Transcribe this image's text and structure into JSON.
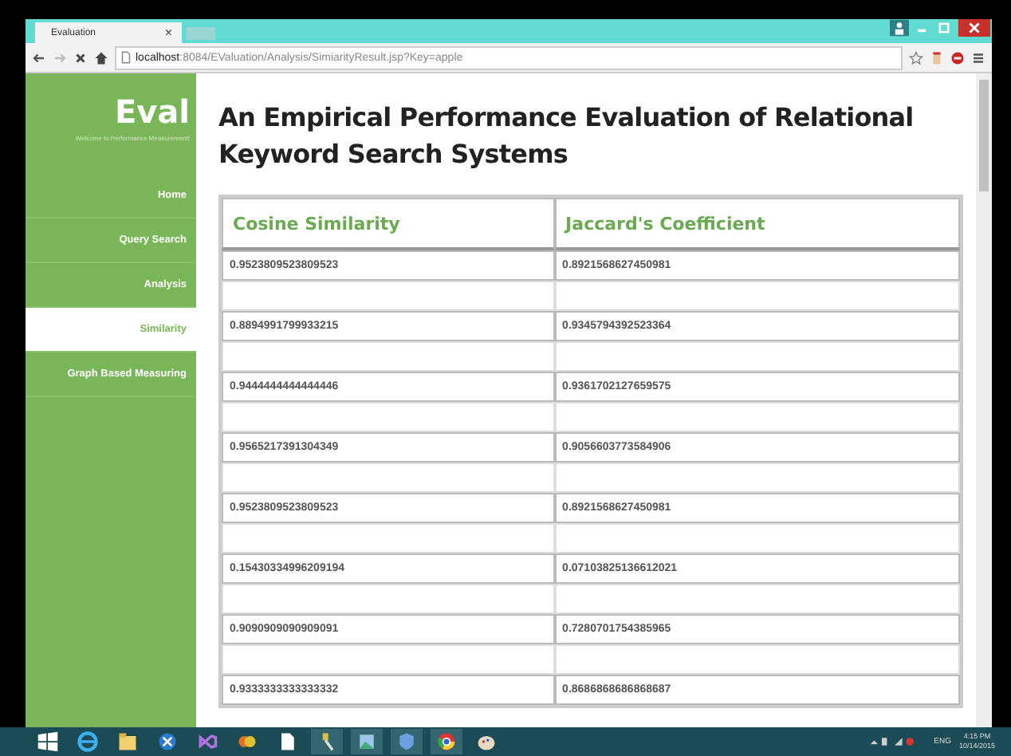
{
  "browser": {
    "tab_title": "Evaluation",
    "close_tab": "×",
    "url_host": "localhost",
    "url_path": ":8084/EValuation/Analysis/SimiarityResult.jsp?Key=apple"
  },
  "sidebar": {
    "brand": "Eval",
    "tagline": "Welcome to Performance Measurement!",
    "items": [
      {
        "label": "Home",
        "selected": false
      },
      {
        "label": "Query Search",
        "selected": false
      },
      {
        "label": "Analysis",
        "selected": false
      },
      {
        "label": "Similarity",
        "selected": true
      },
      {
        "label": "Graph Based Measuring",
        "selected": false
      }
    ]
  },
  "title": "An Empirical Performance Evaluation of Relational Keyword Search Systems",
  "table": {
    "columns": [
      "Cosine Similarity",
      "Jaccard's Coefficient"
    ],
    "rows": [
      [
        "0.9523809523809523",
        "0.8921568627450981"
      ],
      [
        "0.8894991799933215",
        "0.9345794392523364"
      ],
      [
        "0.9444444444444446",
        "0.9361702127659575"
      ],
      [
        "0.9565217391304349",
        "0.9056603773584906"
      ],
      [
        "0.9523809523809523",
        "0.8921568627450981"
      ],
      [
        "0.15430334996209194",
        "0.07103825136612021"
      ],
      [
        "0.9090909090909091",
        "0.7280701754385965"
      ],
      [
        "0.9333333333333332",
        "0.8686868686868687"
      ]
    ]
  },
  "taskbar": {
    "language": "ENG",
    "time": "4:15 PM",
    "date": "10/14/2015"
  }
}
